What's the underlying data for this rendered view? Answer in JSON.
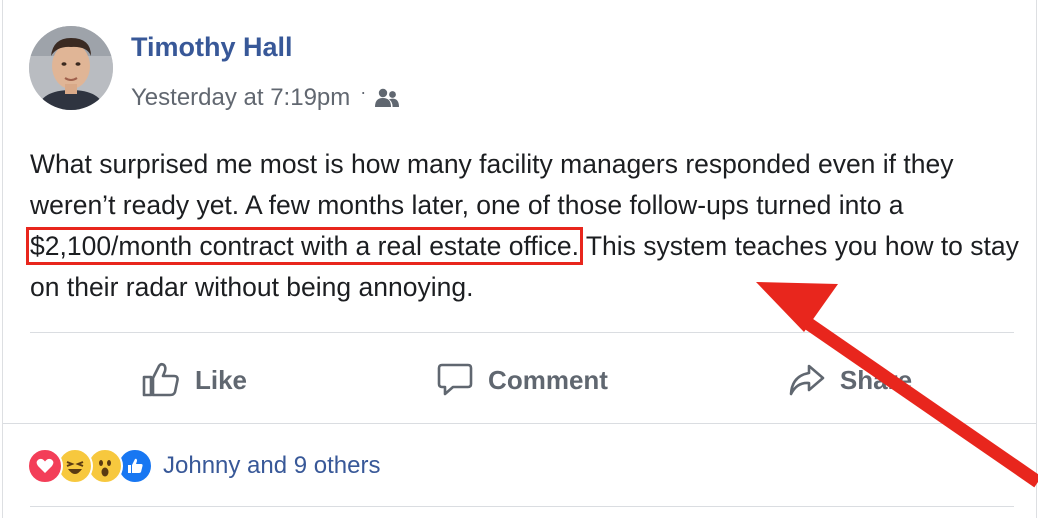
{
  "post": {
    "author": "Timothy Hall",
    "timestamp": "Yesterday at 7:19pm",
    "separator": "·",
    "audience_icon": "friends-icon",
    "text_before": "What surprised me most is how many facility managers responded even if they weren’t ready yet. A few months later, one of those follow-ups turned into a ",
    "text_highlight": "$2,100/month contract with a real estate office.",
    "text_after": " This system teaches you how to stay on their radar without being annoying."
  },
  "actions": {
    "like": "Like",
    "comment": "Comment",
    "share": "Share"
  },
  "reactions": {
    "icons": [
      "love-icon",
      "haha-icon",
      "wow-icon",
      "like-icon"
    ],
    "summary": "Johnny and 9 others"
  },
  "colors": {
    "link": "#385898",
    "annotation_red": "#e8261d",
    "muted": "#606770"
  }
}
